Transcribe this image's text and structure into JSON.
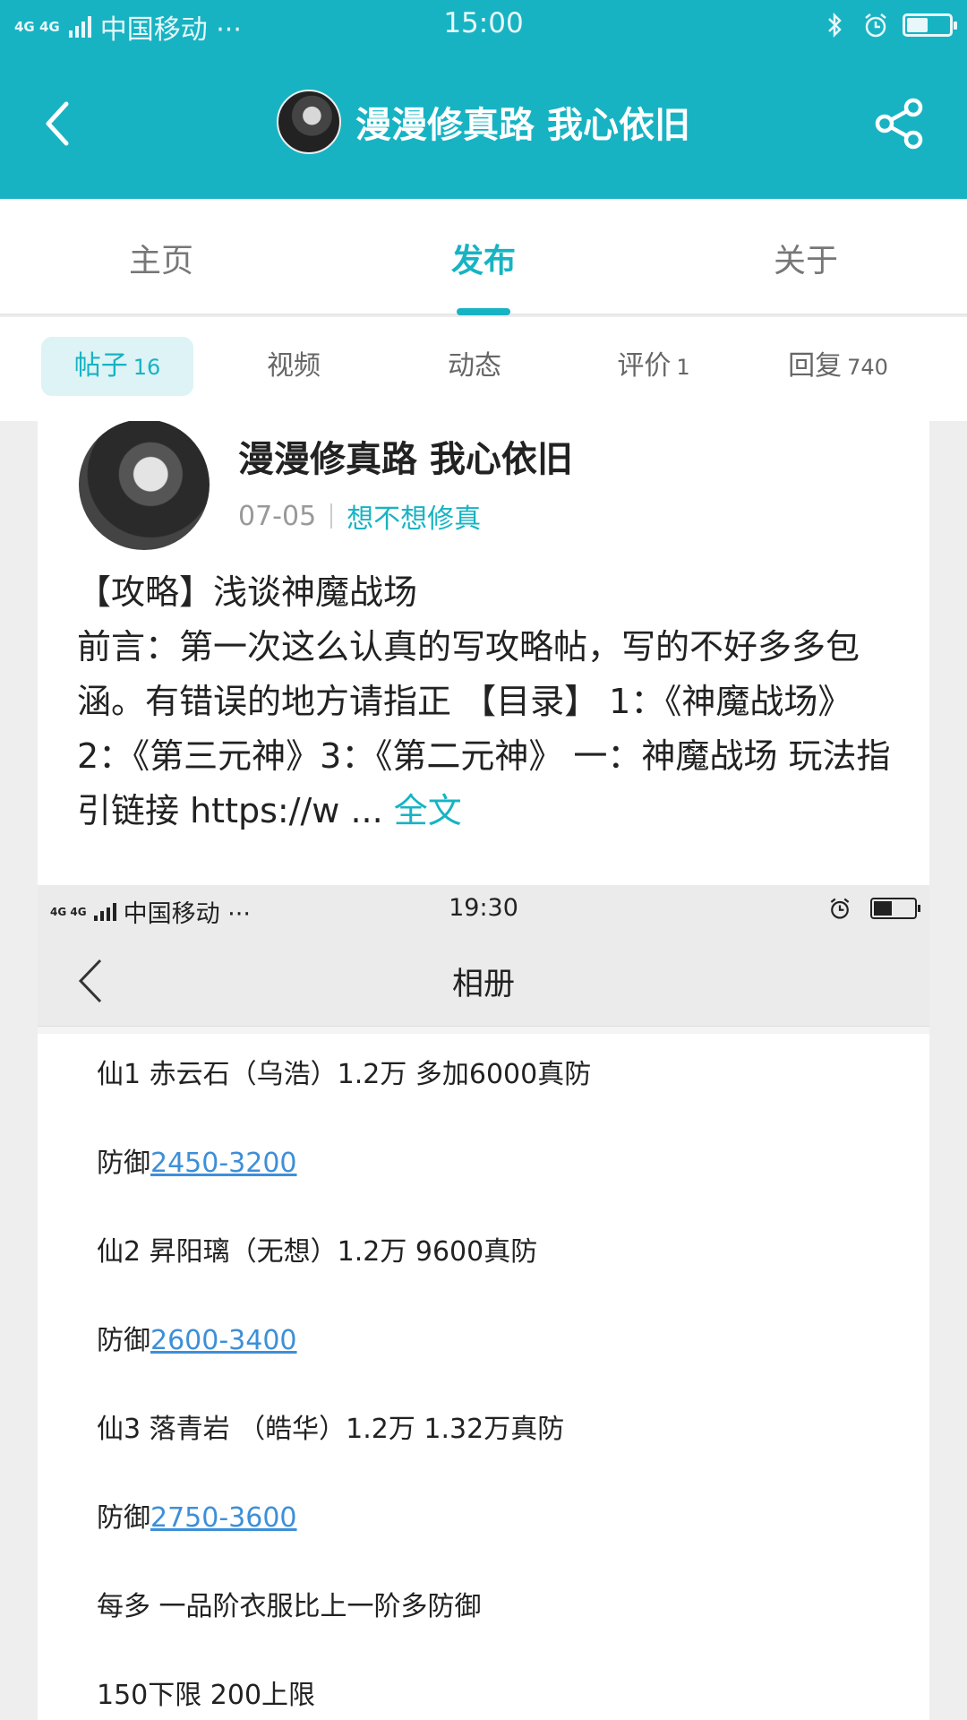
{
  "status_bar": {
    "network": "4G 4G",
    "carrier": "中国移动 ···",
    "time": "15:00",
    "battery_level": 0.5
  },
  "nav": {
    "title": "漫漫修真路 我心依旧",
    "icons": [
      "back-arrow-icon",
      "share-icon"
    ]
  },
  "tabs": [
    {
      "label": "主页"
    },
    {
      "label": "发布",
      "active": true
    },
    {
      "label": "关于"
    }
  ],
  "subtabs": [
    {
      "label": "帖子",
      "count": "16",
      "active": true
    },
    {
      "label": "视频",
      "count": ""
    },
    {
      "label": "动态",
      "count": ""
    },
    {
      "label": "评价",
      "count": "1"
    },
    {
      "label": "回复",
      "count": "740"
    }
  ],
  "post": {
    "author": "漫漫修真路 我心依旧",
    "date": "07-05",
    "topic": "想不想修真",
    "title": "【攻略】浅谈神魔战场",
    "body": "前言：第一次这么认真的写攻略帖，写的不好多多包涵。有错误的地方请指正 【目录】 1：《神魔战场》2：《第三元神》3：《第二元神》 一：神魔战场  玩法指引链接 https://w ...",
    "more_label": "全文"
  },
  "screenshot": {
    "status": {
      "network": "4G 4G",
      "carrier": "中国移动 ···",
      "time": "19:30",
      "battery_level": 0.45
    },
    "title": "相册",
    "lines": [
      {
        "text": "仙1 赤云石（乌浩）1.2万 多加6000真防",
        "link": ""
      },
      {
        "text": "防御",
        "link": "2450-3200"
      },
      {
        "text": "仙2 昇阳璃（无想）1.2万 9600真防",
        "link": ""
      },
      {
        "text": "防御",
        "link": "2600-3400"
      },
      {
        "text": "仙3 落青岩 （皓华）1.2万 1.32万真防",
        "link": ""
      },
      {
        "text": "防御",
        "link": "2750-3600"
      },
      {
        "text": "每多 一品阶衣服比上一阶多防御",
        "link": ""
      },
      {
        "text": "150下限 200上限",
        "link": ""
      }
    ]
  },
  "colors": {
    "accent": "#17b3c3",
    "link": "#3d8fd8"
  }
}
